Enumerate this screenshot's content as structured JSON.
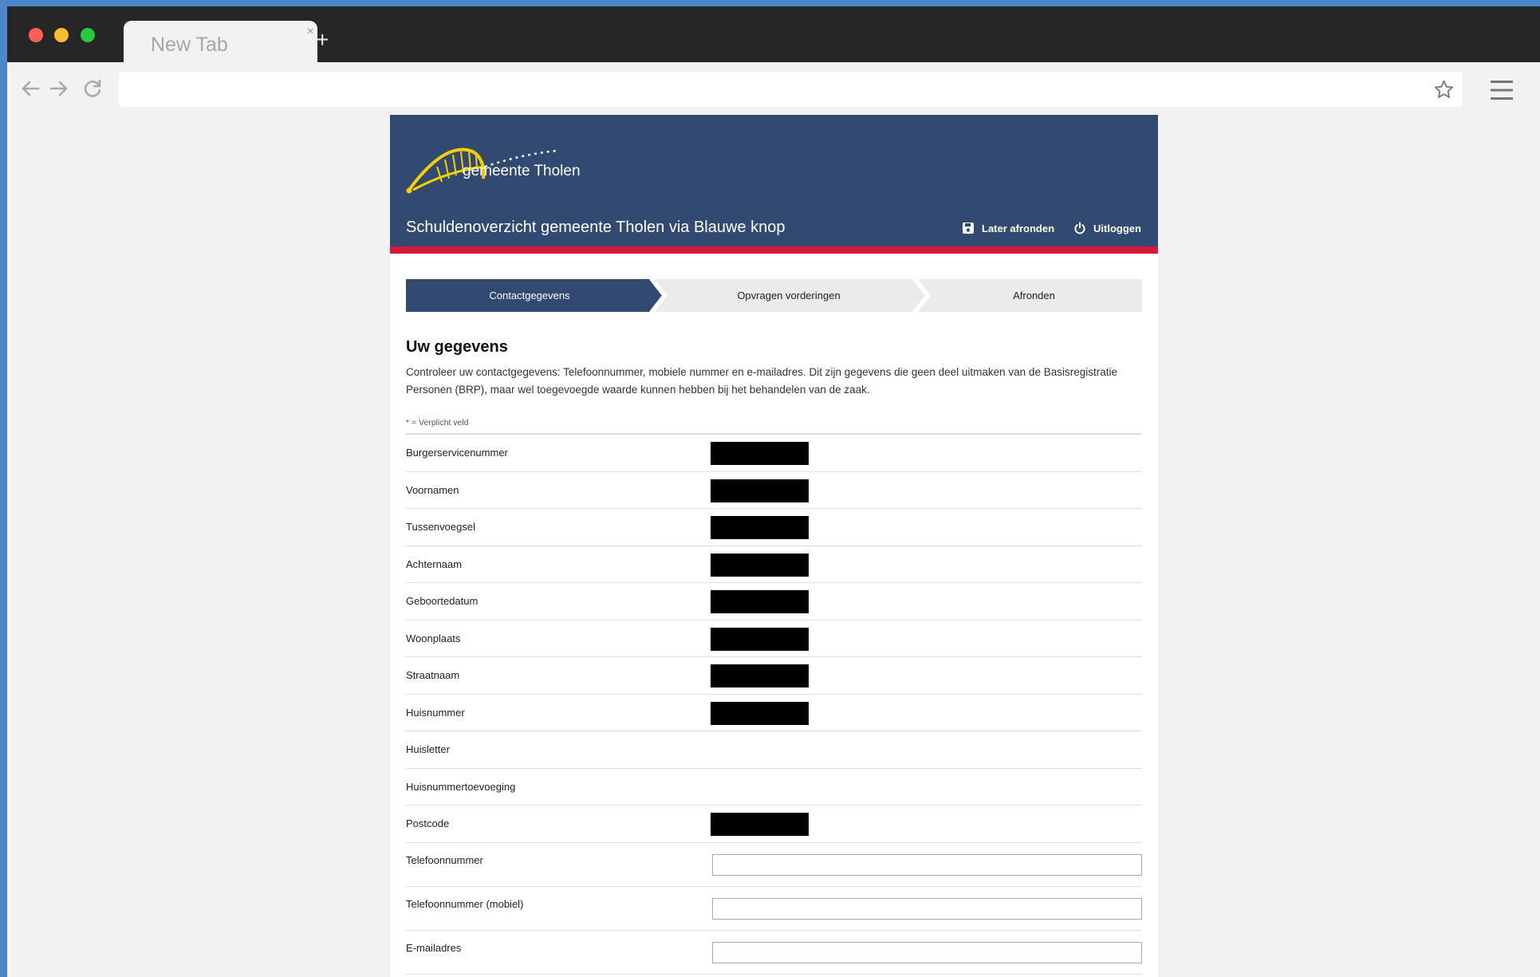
{
  "browser": {
    "tab_title": "New Tab",
    "tab_close": "×",
    "new_tab": "+",
    "address": "",
    "icons": [
      "back-icon",
      "forward-icon",
      "reload-icon",
      "star-icon",
      "menu-icon"
    ]
  },
  "site": {
    "logo_text": "gemeente Tholen",
    "title": "Schuldenoverzicht gemeente Tholen via Blauwe knop",
    "later_label": "Later afronden",
    "logout_label": "Uitloggen",
    "colors": {
      "header": "#324a72",
      "accent": "#d7193a",
      "logo": "#f5d000",
      "step_active": "#324a72",
      "step_inactive": "#ebebeb"
    }
  },
  "steps": [
    {
      "label": "Contactgegevens",
      "active": true
    },
    {
      "label": "Opvragen vorderingen",
      "active": false
    },
    {
      "label": "Afronden",
      "active": false
    }
  ],
  "form": {
    "heading": "Uw gegevens",
    "intro": "Controleer uw contactgegevens: Telefoonnummer, mobiele nummer en e-mailadres. Dit zijn gegevens die geen deel uitmaken van de Basisregistratie Personen (BRP), maar wel toegevoegde waarde kunnen hebben bij het behandelen van de zaak.",
    "required_note": "* = Verplicht veld",
    "rows": [
      {
        "label": "Burgerservicenummer",
        "type": "redacted"
      },
      {
        "label": "Voornamen",
        "type": "redacted"
      },
      {
        "label": "Tussenvoegsel",
        "type": "redacted"
      },
      {
        "label": "Achternaam",
        "type": "redacted"
      },
      {
        "label": "Geboortedatum",
        "type": "redacted"
      },
      {
        "label": "Woonplaats",
        "type": "redacted"
      },
      {
        "label": "Straatnaam",
        "type": "redacted"
      },
      {
        "label": "Huisnummer",
        "type": "redacted"
      },
      {
        "label": "Huisletter",
        "type": "empty"
      },
      {
        "label": "Huisnummertoevoeging",
        "type": "empty"
      },
      {
        "label": "Postcode",
        "type": "redacted"
      },
      {
        "label": "Telefoonnummer",
        "type": "input",
        "value": ""
      },
      {
        "label": "Telefoonnummer (mobiel)",
        "type": "input",
        "value": ""
      },
      {
        "label": "E-mailadres",
        "type": "input",
        "value": ""
      }
    ]
  }
}
